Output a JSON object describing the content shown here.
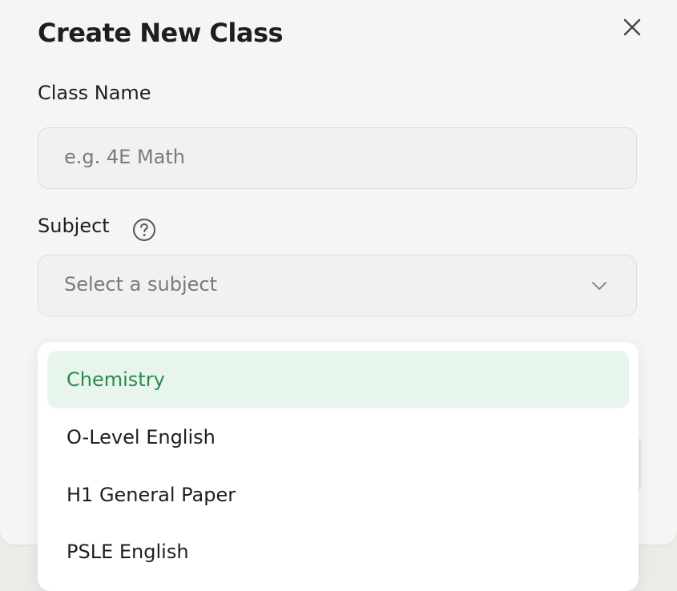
{
  "modal": {
    "title": "Create New Class",
    "close_icon": "close-icon"
  },
  "class_name": {
    "label": "Class Name",
    "placeholder": "e.g. 4E Math",
    "value": ""
  },
  "subject": {
    "label": "Subject",
    "help_icon": "question-circle-icon",
    "placeholder": "Select a subject",
    "chevron_icon": "chevron-down-icon",
    "options": [
      {
        "label": "Chemistry",
        "highlighted": true
      },
      {
        "label": "O-Level English",
        "highlighted": false
      },
      {
        "label": "H1 General Paper",
        "highlighted": false
      },
      {
        "label": "PSLE English",
        "highlighted": false
      }
    ]
  },
  "colors": {
    "highlight_bg": "#e8f5ec",
    "highlight_text": "#2b8a4a",
    "text": "#1e1e1e",
    "placeholder": "#7a7a78"
  }
}
